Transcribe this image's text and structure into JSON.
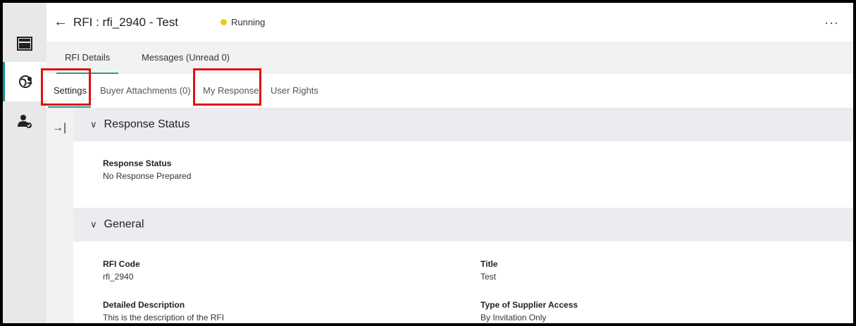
{
  "header": {
    "back_icon": "←",
    "title": "RFI : rfi_2940 - Test",
    "status": "Running",
    "status_color": "#f5c518",
    "more_icon": "···"
  },
  "rail": {
    "items": [
      {
        "icon": "layout-icon",
        "active": false
      },
      {
        "icon": "globe-people-icon",
        "active": true
      },
      {
        "icon": "user-check-icon",
        "active": false
      }
    ]
  },
  "tabs_primary": [
    "RFI Details",
    "Messages (Unread 0)"
  ],
  "tabs_secondary": [
    "Settings",
    "Buyer Attachments (0)",
    "My Response",
    "User Rights"
  ],
  "collapse_icon": "→|",
  "sections": {
    "response_status": {
      "chevron": "∨",
      "title": "Response Status",
      "fields": [
        {
          "label": "Response Status",
          "value": "No Response Prepared"
        }
      ]
    },
    "general": {
      "chevron": "∨",
      "title": "General",
      "fields": [
        {
          "label": "RFI Code",
          "value": "rfi_2940"
        },
        {
          "label": "Title",
          "value": "Test"
        },
        {
          "label": "Detailed Description",
          "value": "This is the description of the RFI"
        },
        {
          "label": "Type of Supplier Access",
          "value": "By Invitation Only"
        }
      ]
    }
  },
  "colors": {
    "accent": "#2a9d8f",
    "highlight": "#e01010"
  }
}
